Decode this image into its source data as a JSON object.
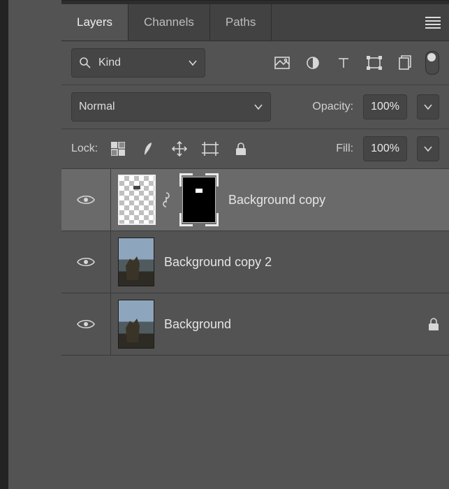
{
  "tabs": {
    "layers": "Layers",
    "channels": "Channels",
    "paths": "Paths"
  },
  "filter": {
    "label": "Kind"
  },
  "blend": {
    "mode": "Normal"
  },
  "opacity": {
    "label": "Opacity:",
    "value": "100%"
  },
  "lock": {
    "label": "Lock:"
  },
  "fill": {
    "label": "Fill:",
    "value": "100%"
  },
  "layers": [
    {
      "name": "Background copy",
      "selected": true,
      "hasMask": true,
      "locked": false,
      "thumb": "checker"
    },
    {
      "name": "Background copy 2",
      "selected": false,
      "hasMask": false,
      "locked": false,
      "thumb": "photo"
    },
    {
      "name": "Background",
      "selected": false,
      "hasMask": false,
      "locked": true,
      "thumb": "photo"
    }
  ]
}
